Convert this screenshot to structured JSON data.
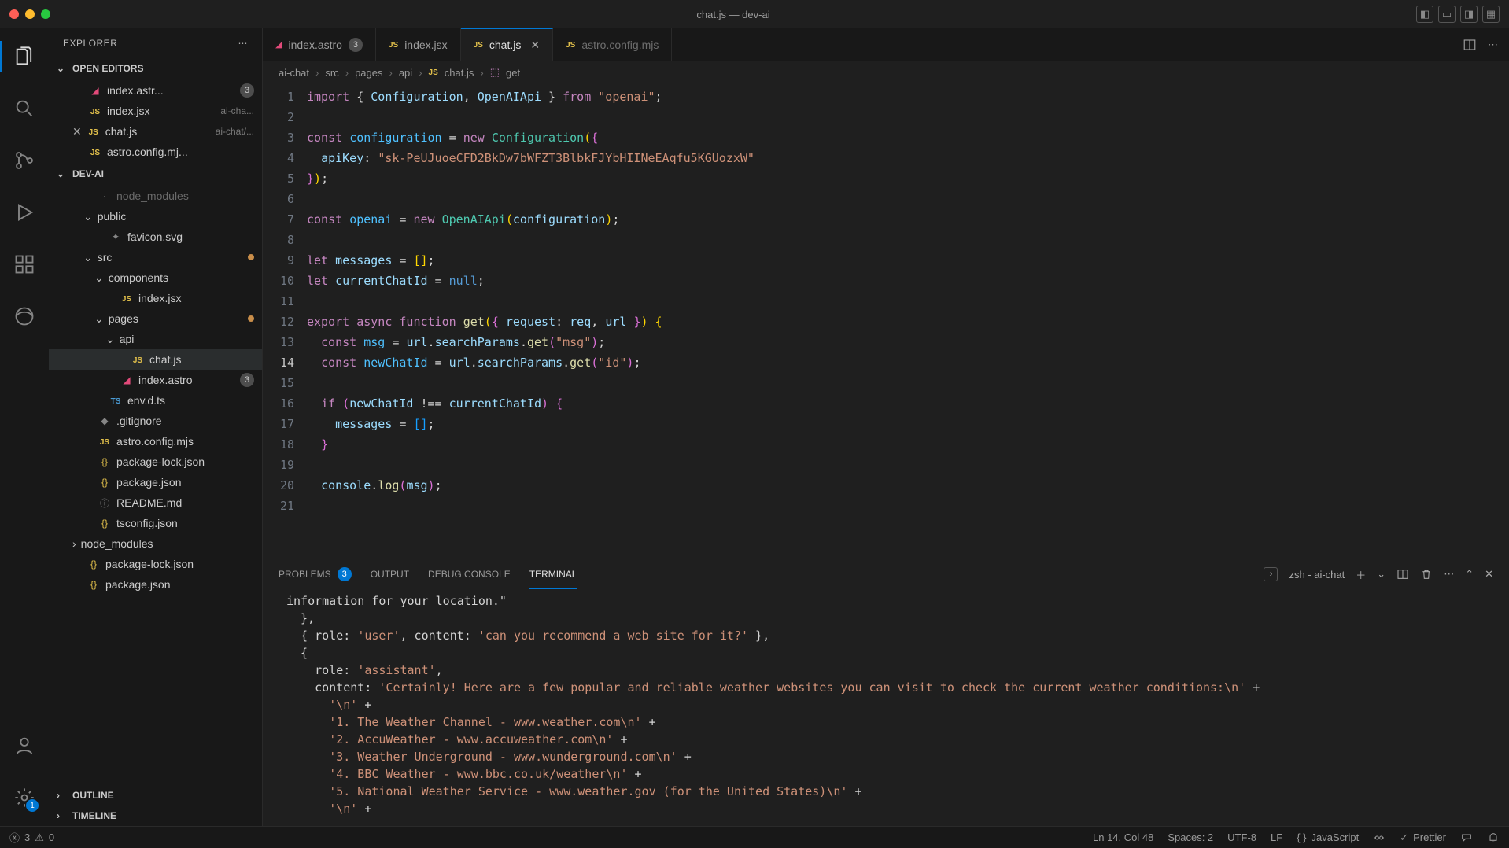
{
  "window": {
    "title": "chat.js — dev-ai"
  },
  "tabs": [
    {
      "icon": "astro",
      "label": "index.astro",
      "badge": "3",
      "active": false
    },
    {
      "icon": "js",
      "label": "index.jsx",
      "active": false
    },
    {
      "icon": "js",
      "label": "chat.js",
      "active": true,
      "closable": true
    },
    {
      "icon": "js",
      "label": "astro.config.mjs",
      "active": false,
      "dim": true
    }
  ],
  "breadcrumb": {
    "parts": [
      "ai-chat",
      "src",
      "pages",
      "api",
      "chat.js",
      "get"
    ],
    "file_icon": "JS",
    "sym_icon": "cube"
  },
  "explorer": {
    "title": "EXPLORER",
    "sections": {
      "open_editors": {
        "label": "OPEN EDITORS",
        "items": [
          {
            "icon": "astro",
            "name": "index.astr...",
            "badge": "3"
          },
          {
            "icon": "js",
            "name": "index.jsx",
            "desc": "ai-cha..."
          },
          {
            "icon": "js",
            "name": "chat.js",
            "desc": "ai-chat/...",
            "closable": true
          },
          {
            "icon": "js",
            "name": "astro.config.mj..."
          }
        ]
      },
      "project": {
        "label": "DEV-AI",
        "tree": [
          {
            "depth": 1,
            "kind": "faded",
            "name": "node_modules"
          },
          {
            "depth": 1,
            "kind": "folder-open",
            "name": "public"
          },
          {
            "depth": 2,
            "kind": "file",
            "icon": "star",
            "name": "favicon.svg"
          },
          {
            "depth": 1,
            "kind": "folder-open",
            "name": "src",
            "modified": true
          },
          {
            "depth": 2,
            "kind": "folder-open",
            "name": "components"
          },
          {
            "depth": 3,
            "kind": "file",
            "icon": "js",
            "name": "index.jsx"
          },
          {
            "depth": 2,
            "kind": "folder-open",
            "name": "pages",
            "modified": true
          },
          {
            "depth": 3,
            "kind": "folder-open",
            "name": "api"
          },
          {
            "depth": 4,
            "kind": "file",
            "icon": "js",
            "name": "chat.js",
            "selected": true
          },
          {
            "depth": 3,
            "kind": "file",
            "icon": "astro",
            "name": "index.astro",
            "badge": "3"
          },
          {
            "depth": 2,
            "kind": "file",
            "icon": "ts",
            "name": "env.d.ts"
          },
          {
            "depth": 1,
            "kind": "file",
            "icon": "git",
            "name": ".gitignore"
          },
          {
            "depth": 1,
            "kind": "file",
            "icon": "js",
            "name": "astro.config.mjs"
          },
          {
            "depth": 1,
            "kind": "file",
            "icon": "json",
            "name": "package-lock.json"
          },
          {
            "depth": 1,
            "kind": "file",
            "icon": "json",
            "name": "package.json"
          },
          {
            "depth": 1,
            "kind": "file",
            "icon": "info",
            "name": "README.md"
          },
          {
            "depth": 1,
            "kind": "file",
            "icon": "json",
            "name": "tsconfig.json"
          },
          {
            "depth": 0,
            "kind": "folder",
            "name": "node_modules"
          },
          {
            "depth": 0,
            "kind": "file",
            "icon": "json",
            "name": "package-lock.json"
          },
          {
            "depth": 0,
            "kind": "file",
            "icon": "json",
            "name": "package.json"
          }
        ]
      },
      "outline": {
        "label": "OUTLINE"
      },
      "timeline": {
        "label": "TIMELINE"
      }
    }
  },
  "code": {
    "start_line": 1,
    "lines": [
      [
        [
          "kw",
          "import"
        ],
        [
          "punc",
          " { "
        ],
        [
          "var",
          "Configuration"
        ],
        [
          "punc",
          ", "
        ],
        [
          "var",
          "OpenAIApi"
        ],
        [
          "punc",
          " } "
        ],
        [
          "kw",
          "from"
        ],
        [
          "punc",
          " "
        ],
        [
          "str",
          "\"openai\""
        ],
        [
          "punc",
          ";"
        ]
      ],
      [],
      [
        [
          "kw",
          "const"
        ],
        [
          "punc",
          " "
        ],
        [
          "const",
          "configuration"
        ],
        [
          "punc",
          " "
        ],
        [
          "op",
          "="
        ],
        [
          "punc",
          " "
        ],
        [
          "kw",
          "new"
        ],
        [
          "punc",
          " "
        ],
        [
          "cls",
          "Configuration"
        ],
        [
          "p",
          "("
        ],
        [
          "b1",
          "{"
        ]
      ],
      [
        [
          "punc",
          "  "
        ],
        [
          "var",
          "apiKey"
        ],
        [
          "punc",
          ": "
        ],
        [
          "str",
          "\"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\""
        ]
      ],
      [
        [
          "b1",
          "}"
        ],
        [
          "p",
          ")"
        ],
        [
          "punc",
          ";"
        ]
      ],
      [],
      [
        [
          "kw",
          "const"
        ],
        [
          "punc",
          " "
        ],
        [
          "const",
          "openai"
        ],
        [
          "punc",
          " "
        ],
        [
          "op",
          "="
        ],
        [
          "punc",
          " "
        ],
        [
          "kw",
          "new"
        ],
        [
          "punc",
          " "
        ],
        [
          "cls",
          "OpenAIApi"
        ],
        [
          "p",
          "("
        ],
        [
          "var",
          "configuration"
        ],
        [
          "p",
          ")"
        ],
        [
          "punc",
          ";"
        ]
      ],
      [],
      [
        [
          "kw",
          "let"
        ],
        [
          "punc",
          " "
        ],
        [
          "var",
          "messages"
        ],
        [
          "punc",
          " "
        ],
        [
          "op",
          "="
        ],
        [
          "punc",
          " "
        ],
        [
          "p",
          "["
        ],
        [
          "p",
          "]"
        ],
        [
          "punc",
          ";"
        ]
      ],
      [
        [
          "kw",
          "let"
        ],
        [
          "punc",
          " "
        ],
        [
          "var",
          "currentChatId"
        ],
        [
          "punc",
          " "
        ],
        [
          "op",
          "="
        ],
        [
          "punc",
          " "
        ],
        [
          "null",
          "null"
        ],
        [
          "punc",
          ";"
        ]
      ],
      [],
      [
        [
          "kw",
          "export"
        ],
        [
          "punc",
          " "
        ],
        [
          "kw",
          "async"
        ],
        [
          "punc",
          " "
        ],
        [
          "kw",
          "function"
        ],
        [
          "punc",
          " "
        ],
        [
          "fn",
          "get"
        ],
        [
          "p",
          "("
        ],
        [
          "b1",
          "{"
        ],
        [
          "punc",
          " "
        ],
        [
          "var",
          "request"
        ],
        [
          "punc",
          ": "
        ],
        [
          "var",
          "req"
        ],
        [
          "punc",
          ", "
        ],
        [
          "var",
          "url"
        ],
        [
          "punc",
          " "
        ],
        [
          "b1",
          "}"
        ],
        [
          "p",
          ")"
        ],
        [
          "punc",
          " "
        ],
        [
          "p",
          "{"
        ]
      ],
      [
        [
          "punc",
          "  "
        ],
        [
          "kw",
          "const"
        ],
        [
          "punc",
          " "
        ],
        [
          "const",
          "msg"
        ],
        [
          "punc",
          " "
        ],
        [
          "op",
          "="
        ],
        [
          "punc",
          " "
        ],
        [
          "var",
          "url"
        ],
        [
          "punc",
          "."
        ],
        [
          "var",
          "searchParams"
        ],
        [
          "punc",
          "."
        ],
        [
          "fn",
          "get"
        ],
        [
          "b1",
          "("
        ],
        [
          "str",
          "\"msg\""
        ],
        [
          "b1",
          ")"
        ],
        [
          "punc",
          ";"
        ]
      ],
      [
        [
          "punc",
          "  "
        ],
        [
          "kw",
          "const"
        ],
        [
          "punc",
          " "
        ],
        [
          "const",
          "newChatId"
        ],
        [
          "punc",
          " "
        ],
        [
          "op",
          "="
        ],
        [
          "punc",
          " "
        ],
        [
          "var",
          "url"
        ],
        [
          "punc",
          "."
        ],
        [
          "var",
          "searchParams"
        ],
        [
          "punc",
          "."
        ],
        [
          "fn",
          "get"
        ],
        [
          "b1",
          "("
        ],
        [
          "str",
          "\"id\""
        ],
        [
          "b1",
          ")"
        ],
        [
          "punc",
          ";"
        ]
      ],
      [],
      [
        [
          "punc",
          "  "
        ],
        [
          "kw",
          "if"
        ],
        [
          "punc",
          " "
        ],
        [
          "b1",
          "("
        ],
        [
          "var",
          "newChatId"
        ],
        [
          "punc",
          " "
        ],
        [
          "op",
          "!=="
        ],
        [
          "punc",
          " "
        ],
        [
          "var",
          "currentChatId"
        ],
        [
          "b1",
          ")"
        ],
        [
          "punc",
          " "
        ],
        [
          "b1",
          "{"
        ]
      ],
      [
        [
          "punc",
          "    "
        ],
        [
          "var",
          "messages"
        ],
        [
          "punc",
          " "
        ],
        [
          "op",
          "="
        ],
        [
          "punc",
          " "
        ],
        [
          "b2",
          "["
        ],
        [
          "b2",
          "]"
        ],
        [
          "punc",
          ";"
        ]
      ],
      [
        [
          "punc",
          "  "
        ],
        [
          "b1",
          "}"
        ]
      ],
      [],
      [
        [
          "punc",
          "  "
        ],
        [
          "var",
          "console"
        ],
        [
          "punc",
          "."
        ],
        [
          "fn",
          "log"
        ],
        [
          "b1",
          "("
        ],
        [
          "var",
          "msg"
        ],
        [
          "b1",
          ")"
        ],
        [
          "punc",
          ";"
        ]
      ],
      []
    ],
    "cursor_line_index": 13
  },
  "panel": {
    "tabs": {
      "problems": {
        "label": "PROBLEMS",
        "count": "3"
      },
      "output": "OUTPUT",
      "debug": "DEBUG CONSOLE",
      "terminal": "TERMINAL"
    },
    "shell": "zsh - ai-chat",
    "terminal_lines": [
      "information for your location.\"",
      "  },",
      "  { role: 'user', content: 'can you recommend a web site for it?' },",
      "  {",
      "    role: 'assistant',",
      "    content: 'Certainly! Here are a few popular and reliable weather websites you can visit to check the current weather conditions:\\n' +",
      "      '\\n' +",
      "      '1. The Weather Channel - www.weather.com\\n' +",
      "      '2. AccuWeather - www.accuweather.com\\n' +",
      "      '3. Weather Underground - www.wunderground.com\\n' +",
      "      '4. BBC Weather - www.bbc.co.uk/weather\\n' +",
      "      '5. National Weather Service - www.weather.gov (for the United States)\\n' +",
      "      '\\n' +"
    ]
  },
  "status": {
    "errors": "3",
    "warnings": "0",
    "position": "Ln 14, Col 48",
    "spaces": "Spaces: 2",
    "encoding": "UTF-8",
    "eol": "LF",
    "lang": "JavaScript",
    "prettier": "Prettier"
  },
  "settings_badge": "1"
}
